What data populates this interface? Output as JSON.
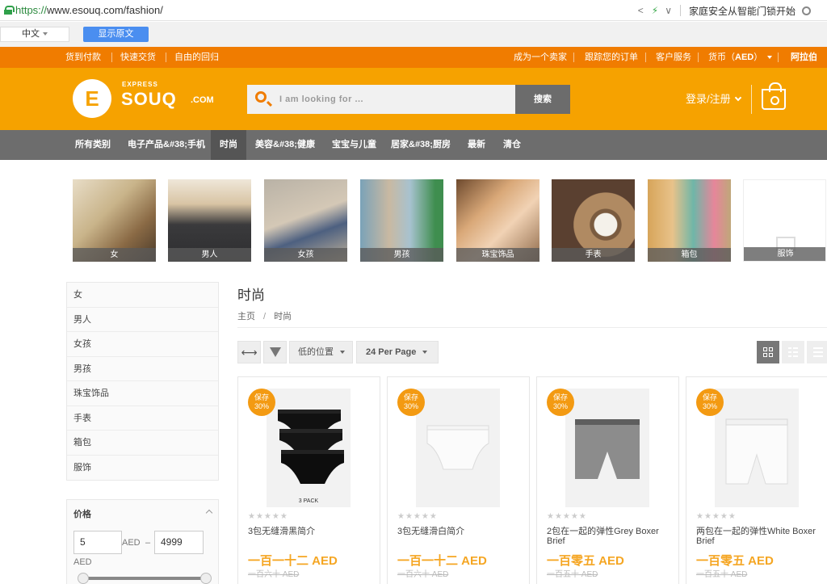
{
  "browser": {
    "url_scheme": "https://",
    "url_rest": "www.esouq.com/fashion/",
    "share_icon": "share-icon",
    "bolt_icon": "bolt-icon",
    "chevron_glyph": "∨",
    "search_suggestion": "家庭安全从智能门锁开始"
  },
  "translate_bar": {
    "language": "中文",
    "show_original": "显示原文"
  },
  "topbar": {
    "left_links": [
      "货到付款",
      "快速交货",
      "自由的回归"
    ],
    "right_links": [
      "成为一个卖家",
      "跟踪您的订单",
      "客户服务"
    ],
    "currency_label": "货币（",
    "currency_code": "AED",
    "currency_close": "）",
    "language": "阿拉伯"
  },
  "header": {
    "logo_letter": "E",
    "logo_express": "EXPRESS",
    "logo_souq": "SOUQ",
    "logo_com": ".COM",
    "search_placeholder": "I am looking for ...",
    "search_button": "搜索",
    "login": "登录/注册"
  },
  "nav": {
    "items": [
      "所有类别",
      "电子产品&#38;手机",
      "时尚",
      "美容&#38;健康",
      "宝宝与儿童",
      "居家&#38;厨房",
      "最新",
      "清仓"
    ],
    "active": "时尚"
  },
  "categories": [
    "女",
    "男人",
    "女孩",
    "男孩",
    "珠宝饰品",
    "手表",
    "箱包",
    "服饰"
  ],
  "sidebar": {
    "items": [
      "女",
      "男人",
      "女孩",
      "男孩",
      "珠宝饰品",
      "手表",
      "箱包",
      "服饰"
    ],
    "price": {
      "title": "价格",
      "min": "5",
      "max": "4999",
      "currency": "AED",
      "dash": "–",
      "range_low": 0,
      "range_high": 1
    }
  },
  "main": {
    "title": "时尚",
    "breadcrumb": [
      "主页",
      "时尚"
    ],
    "breadcrumb_sep": "/",
    "sort_label": "低的位置",
    "per_page": "24 Per Page",
    "arrows_glyph": "⟷"
  },
  "products": [
    {
      "badge_top": "保存",
      "badge_pct": "30%",
      "name": "3包无缝滑黑简介",
      "price": "一百一十二 AED",
      "old_price": "一百六十 AED",
      "pack_label": "3 PACK",
      "stars": "★★★★★"
    },
    {
      "badge_top": "保存",
      "badge_pct": "30%",
      "name": "3包无缝滑白简介",
      "price": "一百一十二 AED",
      "old_price": "一百六十 AED",
      "stars": "★★★★★"
    },
    {
      "badge_top": "保存",
      "badge_pct": "30%",
      "name": "2包在一起的弹性Grey Boxer Brief",
      "price": "一百零五 AED",
      "old_price": "一百五十 AED",
      "stars": "★★★★★"
    },
    {
      "badge_top": "保存",
      "badge_pct": "30%",
      "name": "两包在一起的弹性White Boxer Brief",
      "price": "一百零五 AED",
      "old_price": "一百五十 AED",
      "stars": "★★★★★"
    }
  ],
  "colors": {
    "topbar": "#f07c00",
    "header": "#f6a200",
    "nav": "#6d6d6d",
    "price": "#f5a623"
  }
}
